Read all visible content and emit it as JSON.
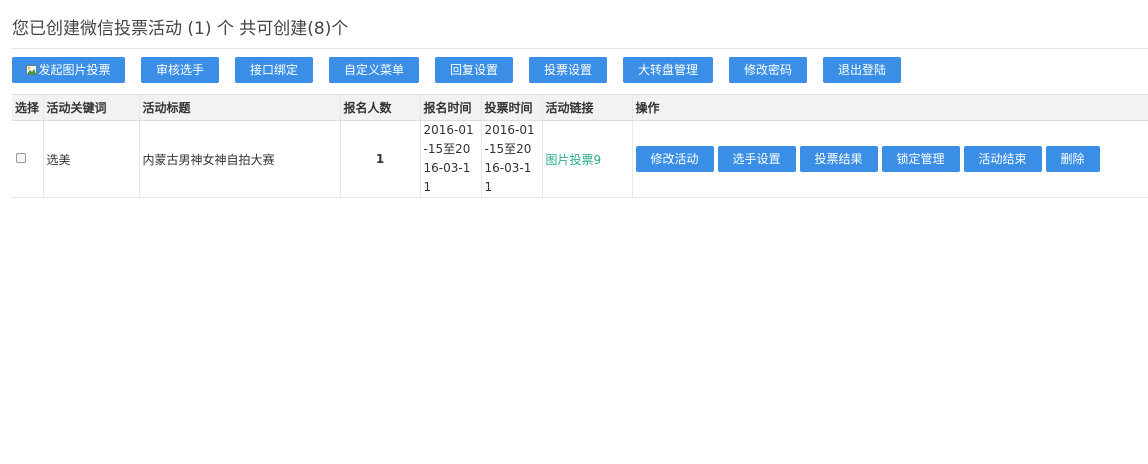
{
  "header": {
    "title": "您已创建微信投票活动 (1) 个 共可创建(8)个"
  },
  "toolbar": {
    "buttons": [
      {
        "label": "发起图片投票",
        "icon": "picture-icon"
      },
      {
        "label": "审核选手"
      },
      {
        "label": "接口绑定"
      },
      {
        "label": "自定义菜单"
      },
      {
        "label": "回复设置"
      },
      {
        "label": "投票设置"
      },
      {
        "label": "大转盘管理"
      },
      {
        "label": "修改密码"
      },
      {
        "label": "退出登陆"
      }
    ]
  },
  "table": {
    "columns": [
      "选择",
      "活动关键词",
      "活动标题",
      "报名人数",
      "报名时间",
      "投票时间",
      "活动链接",
      "操作"
    ],
    "rows": [
      {
        "keyword": "选美",
        "title": "内蒙古男神女神自拍大赛",
        "signups": "1",
        "signup_time": "2016-01-15至2016-03-11",
        "vote_time": "2016-01-15至2016-03-11",
        "link": "图片投票9",
        "actions": [
          "修改活动",
          "选手设置",
          "投票结果",
          "锁定管理",
          "活动结束",
          "删除"
        ]
      }
    ]
  },
  "colors": {
    "button": "#3a8ee6",
    "link": "#2bab8d",
    "header_bg": "#f2f2f2"
  }
}
